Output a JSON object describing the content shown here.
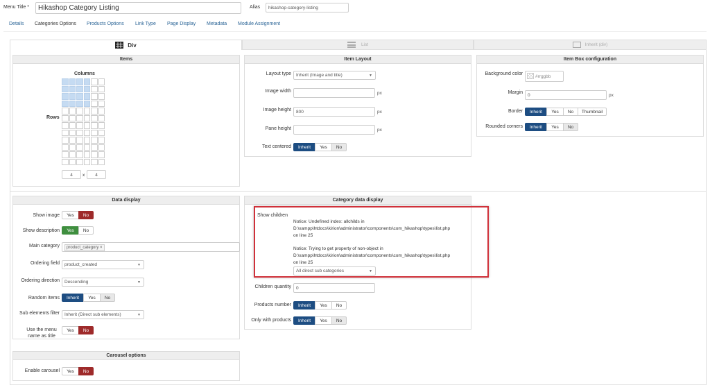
{
  "header": {
    "menu_title_label": "Menu Title *",
    "menu_title_value": "Hikashop Category Listing",
    "alias_label": "Alias",
    "alias_value": "hikashop-category-listing"
  },
  "tabs": [
    {
      "label": "Details"
    },
    {
      "label": "Categories Options"
    },
    {
      "label": "Products Options"
    },
    {
      "label": "Link Type"
    },
    {
      "label": "Page Display"
    },
    {
      "label": "Metadata"
    },
    {
      "label": "Module Assignment"
    }
  ],
  "layout_tabs": {
    "div": "Div",
    "list": "List",
    "inherit": "Inherit (div)"
  },
  "items": {
    "title": "Items",
    "columns_label": "Columns",
    "rows_label": "Rows",
    "columns_value": "4",
    "x": "x",
    "rows_value": "4"
  },
  "item_layout": {
    "title": "Item Layout",
    "layout_type_label": "Layout type",
    "layout_type_value": "Inherit (Image and title)",
    "image_width_label": "Image width",
    "image_width_value": "",
    "image_height_label": "Image height",
    "image_height_value": "800",
    "pane_height_label": "Pane height",
    "pane_height_value": "",
    "text_centered_label": "Text centered",
    "px": "px"
  },
  "item_box": {
    "title": "Item Box configuration",
    "background_color_label": "Background color",
    "background_color_value": "#rrggbb",
    "margin_label": "Margin",
    "margin_value": "0",
    "border_label": "Border",
    "rounded_label": "Rounded corners",
    "thumbnail": "Thumbnail"
  },
  "buttons": {
    "inherit": "Inherit",
    "yes": "Yes",
    "no": "No"
  },
  "data_display": {
    "title": "Data display",
    "show_image_label": "Show image",
    "show_description_label": "Show description",
    "main_category_label": "Main category",
    "main_category_tag": "product_category",
    "ordering_field_label": "Ordering field",
    "ordering_field_value": "product_created",
    "ordering_direction_label": "Ordering direction",
    "ordering_direction_value": "Descending",
    "random_items_label": "Random items",
    "sub_elements_label": "Sub elements filter",
    "sub_elements_value": "Inherit (Direct sub elements)",
    "use_menu_name_label_1": "Use the menu",
    "use_menu_name_label_2": "name as title"
  },
  "category_display": {
    "title": "Category data display",
    "show_children_label": "Show children",
    "notice1_line1": "Notice: Undefined index: allchilds in",
    "notice1_line2": "D:\\xampp\\htdocs\\kirion\\administrator\\components\\com_hikashop\\types\\list.php",
    "notice1_line3": "on line 25",
    "notice2_line1": "Notice: Trying to get property of non-object in",
    "notice2_line2": "D:\\xampp\\htdocs\\kirion\\administrator\\components\\com_hikashop\\types\\list.php",
    "notice2_line3": "on line 25",
    "show_children_value": "All direct sub categories",
    "children_quantity_label": "Children quantity",
    "children_quantity_value": "0",
    "products_number_label": "Products number",
    "only_with_products_label": "Only with products"
  },
  "carousel": {
    "title": "Carousel options",
    "enable_label": "Enable carousel"
  },
  "colors": {
    "blue": "#1d4d82",
    "green": "#3f8f3f",
    "red": "#9e2a2a",
    "highlight": "#d0313a"
  }
}
